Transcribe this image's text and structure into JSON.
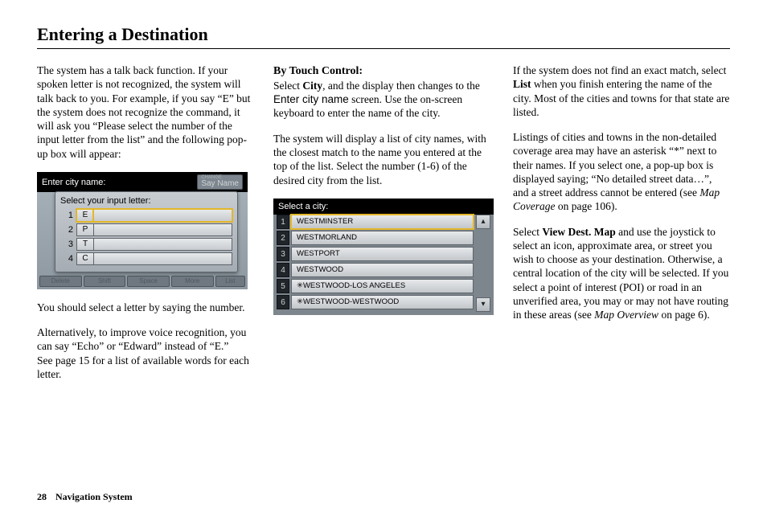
{
  "title": "Entering a Destination",
  "col1": {
    "p1": "The system has a talk back function. If your spoken letter is not recognized, the system will talk back to you. For example, if you say “E” but the system does not recognize the command, it will ask you “Please select the number of the input letter from the list” and the following pop-up box will appear:",
    "p2": "You should select a letter by saying the number.",
    "p3a": "Alternatively, to improve voice recognition, you can say “Echo” or “Edward” instead of “E.”",
    "p3b": "See page 15 for a list of available words for each letter."
  },
  "col2": {
    "subhead": "By Touch Control:",
    "p1a": "Select ",
    "p1b": "City",
    "p1c": ", and the display then changes to the ",
    "p1d": "Enter city name",
    "p1e": " screen. Use the on-screen keyboard to enter the name of the city.",
    "p2": "The system will display a list of city names, with the closest match to the name you entered at the top of the list. Select the number (1-6) of the desired city from the list."
  },
  "col3": {
    "p1a": "If the system does not find an exact match, select ",
    "p1b": "List",
    "p1c": " when you finish entering the name of the city. Most of the cities and towns for that state are listed.",
    "p2a": "Listings of cities and towns in the non-detailed coverage area may have an asterisk “*” next to their names. If you select one, a pop-up box is displayed saying; “No detailed street data…”, and a street address cannot be entered (see ",
    "p2b": "Map Coverage",
    "p2c": " on page 106).",
    "p3a": "Select ",
    "p3b": "View Dest. Map",
    "p3c": " and use the joystick to select an icon, approximate area, or street you wish to choose as your destination. Otherwise, a central location of the city will be selected. If you select a point of interest (POI) or road in an unverified area, you may or may not have routing in these areas (see ",
    "p3d": "Map Overview",
    "p3e": " on page 6)."
  },
  "shot1": {
    "header": "Enter city name:",
    "change": "CHANGE",
    "say": "Say Name",
    "popup_title": "Select your input letter:",
    "rows": [
      {
        "n": "1",
        "l": "E"
      },
      {
        "n": "2",
        "l": "P"
      },
      {
        "n": "3",
        "l": "T"
      },
      {
        "n": "4",
        "l": "C"
      }
    ],
    "btns": [
      "Delete",
      "Shift",
      "Space",
      "More",
      "List"
    ]
  },
  "shot2": {
    "header": "Select a city:",
    "rows": [
      {
        "n": "1",
        "l": "WESTMINSTER"
      },
      {
        "n": "2",
        "l": "WESTMORLAND"
      },
      {
        "n": "3",
        "l": "WESTPORT"
      },
      {
        "n": "4",
        "l": "WESTWOOD"
      },
      {
        "n": "5",
        "l": "✳WESTWOOD-LOS ANGELES"
      },
      {
        "n": "6",
        "l": "✳WESTWOOD-WESTWOOD"
      }
    ],
    "up": "▴",
    "down": "▾"
  },
  "footer": {
    "page": "28",
    "section": "Navigation System"
  }
}
